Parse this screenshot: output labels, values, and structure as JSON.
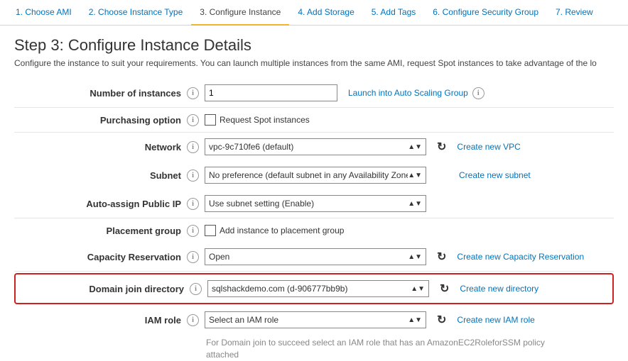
{
  "tabs": [
    {
      "label": "1. Choose AMI",
      "active": false
    },
    {
      "label": "2. Choose Instance Type",
      "active": false
    },
    {
      "label": "3. Configure Instance",
      "active": true
    },
    {
      "label": "4. Add Storage",
      "active": false
    },
    {
      "label": "5. Add Tags",
      "active": false
    },
    {
      "label": "6. Configure Security Group",
      "active": false
    },
    {
      "label": "7. Review",
      "active": false
    }
  ],
  "header": {
    "title": "Step 3: Configure Instance Details",
    "description": "Configure the instance to suit your requirements. You can launch multiple instances from the same AMI, request Spot instances to take advantage of the lo"
  },
  "form": {
    "number_of_instances": {
      "label": "Number of instances",
      "value": "1",
      "link": "Launch into Auto Scaling Group"
    },
    "purchasing_option": {
      "label": "Purchasing option",
      "checkbox": "Request Spot instances"
    },
    "network": {
      "label": "Network",
      "value": "vpc-9c710fe6 (default)",
      "link": "Create new VPC"
    },
    "subnet": {
      "label": "Subnet",
      "value": "No preference (default subnet in any Availability Zone)",
      "link": "Create new subnet"
    },
    "auto_assign_ip": {
      "label": "Auto-assign Public IP",
      "value": "Use subnet setting (Enable)"
    },
    "placement_group": {
      "label": "Placement group",
      "checkbox": "Add instance to placement group"
    },
    "capacity_reservation": {
      "label": "Capacity Reservation",
      "value": "Open",
      "link": "Create new Capacity Reservation"
    },
    "domain_join": {
      "label": "Domain join directory",
      "value": "sqlshackdemo.com (d-906777bb9b)",
      "link": "Create new directory"
    },
    "iam_role": {
      "label": "IAM role",
      "value": "Select an IAM role",
      "link": "Create new IAM role",
      "hint": "For Domain join to succeed select an IAM role that has an AmazonEC2RoleforSSM policy attached"
    }
  }
}
